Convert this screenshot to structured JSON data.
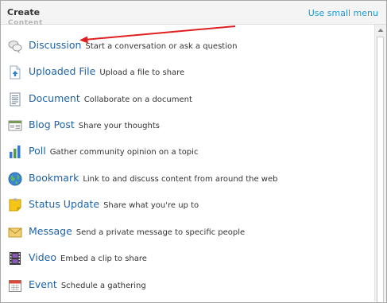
{
  "header": {
    "title": "Create",
    "toggle_link": "Use small menu"
  },
  "section": {
    "label": "Content"
  },
  "items": [
    {
      "name": "Discussion",
      "desc": "Start a conversation or ask a question",
      "icon": "speech-bubbles-icon"
    },
    {
      "name": "Uploaded File",
      "desc": "Upload a file to share",
      "icon": "upload-icon"
    },
    {
      "name": "Document",
      "desc": "Collaborate on a document",
      "icon": "document-icon"
    },
    {
      "name": "Blog Post",
      "desc": "Share your thoughts",
      "icon": "blog-icon"
    },
    {
      "name": "Poll",
      "desc": "Gather community opinion on a topic",
      "icon": "bar-chart-icon"
    },
    {
      "name": "Bookmark",
      "desc": "Link to and discuss content from around the web",
      "icon": "globe-icon"
    },
    {
      "name": "Status Update",
      "desc": "Share what you're up to",
      "icon": "sticky-note-icon"
    },
    {
      "name": "Message",
      "desc": "Send a private message to specific people",
      "icon": "envelope-icon"
    },
    {
      "name": "Video",
      "desc": "Embed a clip to share",
      "icon": "film-icon"
    },
    {
      "name": "Event",
      "desc": "Schedule a gathering",
      "icon": "calendar-icon"
    }
  ],
  "colors": {
    "link": "#1d9bd6",
    "item_name": "#1f63a8",
    "annotation_arrow": "#e02020"
  }
}
